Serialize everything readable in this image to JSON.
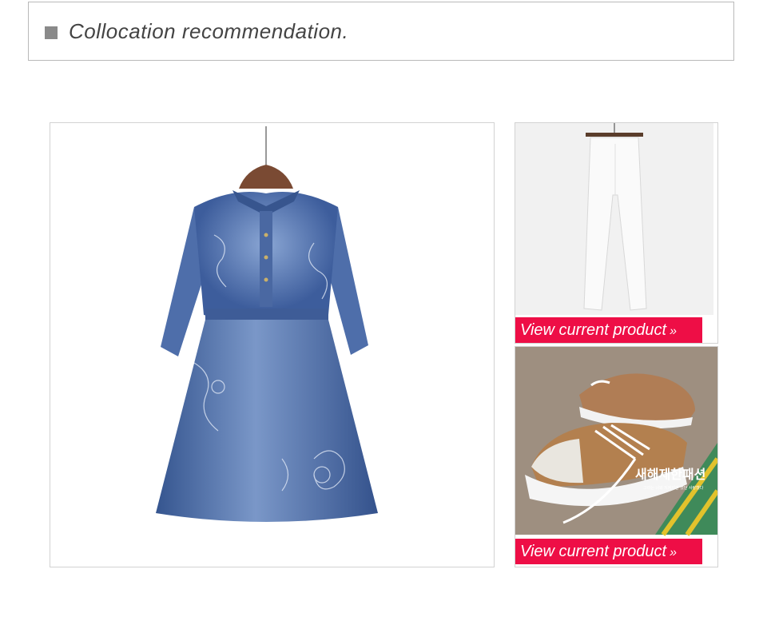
{
  "header": {
    "title": "Collocation recommendation."
  },
  "main_product": {
    "image_alt": "denim-embroidered-dress"
  },
  "side_products": [
    {
      "image_alt": "white-pants",
      "button_label": "View current product",
      "button_suffix": "»"
    },
    {
      "image_alt": "canvas-sneakers",
      "button_label": "View current product",
      "button_suffix": "»",
      "overlay_text": "새해제한패션",
      "overlay_subtext": "그리는 너와 지켜지긴 썼던 사랑했다"
    }
  ],
  "colors": {
    "accent": "#ee0e46",
    "border": "#d2d2d2",
    "denim": "#3d5d9c"
  }
}
